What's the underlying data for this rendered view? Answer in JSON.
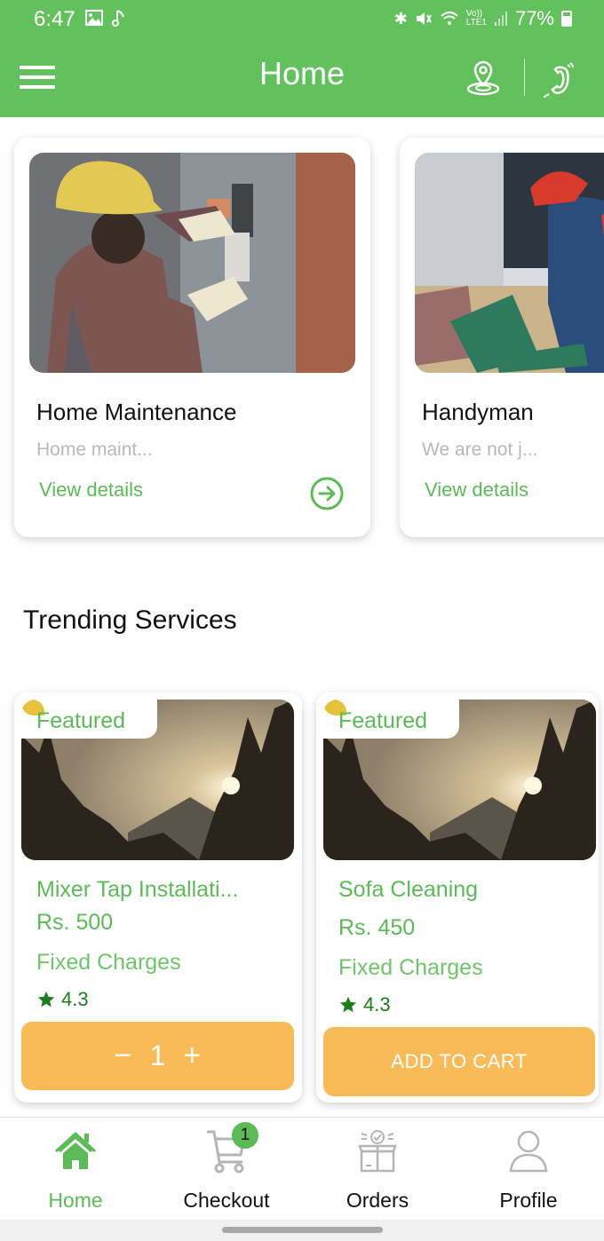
{
  "status_bar": {
    "time": "6:47",
    "left_icons": [
      "gallery-icon",
      "music-note-icon"
    ],
    "right_icons": [
      "bluetooth-icon",
      "mute-icon",
      "wifi-icon",
      "volte-lte-icon",
      "signal-icon"
    ],
    "battery": "77%"
  },
  "app_bar": {
    "title": "Home",
    "menu_icon": "hamburger-menu-icon",
    "location_icon": "location-pin-icon",
    "phone_icon": "phone-call-icon"
  },
  "colors": {
    "primary": "#63c15d",
    "accent_text": "#5cba57",
    "button": "#f8bb58",
    "badge_dot": "#e8c13a",
    "rating": "#1a7f1a"
  },
  "categories": [
    {
      "title": "Home Maintenance",
      "description": "Home maint...",
      "link": "View details",
      "image": "electrician-hard-hat-photo"
    },
    {
      "title": "Handyman",
      "description": "We are not j...",
      "link": "View details",
      "image": "worker-toolbox-photo"
    }
  ],
  "trending": {
    "title": "Trending Services",
    "items": [
      {
        "badge": "Featured",
        "name": "Mixer Tap Installati...",
        "price": "Rs. 500",
        "charge_type": "Fixed Charges",
        "rating": "4.3",
        "quantity": "1",
        "minus": "−",
        "plus": "+",
        "image": "sunset-forest-photo"
      },
      {
        "badge": "Featured",
        "name": "Sofa Cleaning",
        "price": "Rs. 450",
        "charge_type": "Fixed Charges",
        "rating": "4.3",
        "cta": "ADD TO CART",
        "image": "sunset-forest-photo"
      }
    ]
  },
  "bottom_nav": {
    "items": [
      {
        "label": "Home",
        "icon": "home-icon",
        "active": true
      },
      {
        "label": "Checkout",
        "icon": "cart-icon",
        "badge": "1"
      },
      {
        "label": "Orders",
        "icon": "orders-box-icon"
      },
      {
        "label": "Profile",
        "icon": "profile-icon"
      }
    ]
  }
}
